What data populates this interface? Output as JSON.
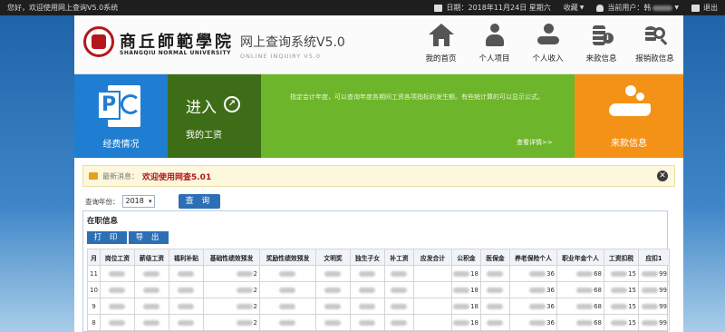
{
  "topbar": {
    "welcome": "您好，欢迎使用网上查询V5.0系统",
    "date": "日期：2018年11月24日 星期六",
    "favorites": "收藏",
    "current_user": "当前用户：",
    "user_name_prefix": "韩",
    "logout": "退出"
  },
  "header": {
    "logo_cn": "商丘師範學院",
    "logo_en": "SHANGQIU NORMAL UNIVERSITY",
    "system_title": "网上查询系统V5.0",
    "system_subtitle": "ONLINE INQUIRY V5.0",
    "nav": [
      {
        "label": "我的首页",
        "icon": "home-icon"
      },
      {
        "label": "个人项目",
        "icon": "person-icon"
      },
      {
        "label": "个人收入",
        "icon": "income-icon"
      },
      {
        "label": "来款信息",
        "icon": "payment-info-icon"
      },
      {
        "label": "报销款信息",
        "icon": "reimbursement-icon"
      }
    ]
  },
  "tiles": {
    "expense": "经费情况",
    "enter": "进入",
    "my_salary": "我的工资",
    "message": "指定会计年度，可以查询年度各期间工资各项指标的发生额。有些统计算的可以显示公式。",
    "more": "查看详情>>",
    "income_info": "来款信息"
  },
  "notice": {
    "label": "最新消息：",
    "text": "欢迎使用网查5.01"
  },
  "query": {
    "year_label": "查询年份：",
    "year_value": "2018",
    "search_button": "查 询"
  },
  "panel": {
    "title": "在职信息",
    "print": "打 印",
    "export": "导 出"
  },
  "table": {
    "headers": [
      "月",
      "岗位工资",
      "薪级工资",
      "福利补贴",
      "基础性绩效预发",
      "奖励性绩效预发",
      "文明奖",
      "独生子女",
      "补工资",
      "应发合计",
      "公积金",
      "医保金",
      "养老保险个人",
      "职业年金个人",
      "工资扣税",
      "应扣1"
    ],
    "rows": [
      {
        "month": "11",
        "c4": "2",
        "c9": "",
        "c10": "18",
        "c12": "36",
        "c13": "68",
        "c14": "15",
        "c15": "99"
      },
      {
        "month": "10",
        "c4": "2",
        "c9": "",
        "c10": "18",
        "c12": "36",
        "c13": "68",
        "c14": "15",
        "c15": "99"
      },
      {
        "month": "9",
        "c4": "2",
        "c9": "",
        "c10": "18",
        "c12": "36",
        "c13": "68",
        "c14": "15",
        "c15": "99"
      },
      {
        "month": "8",
        "c4": "2",
        "c9": "",
        "c10": "18",
        "c12": "36",
        "c13": "68",
        "c14": "15",
        "c15": "99"
      }
    ]
  },
  "colors": {
    "tile_blue": "#1f7ed2",
    "tile_dark_green": "#3e6d17",
    "tile_light_green": "#6db52a",
    "tile_orange": "#f39216",
    "button_blue": "#2c6fb4",
    "notice_red": "#b01818"
  }
}
